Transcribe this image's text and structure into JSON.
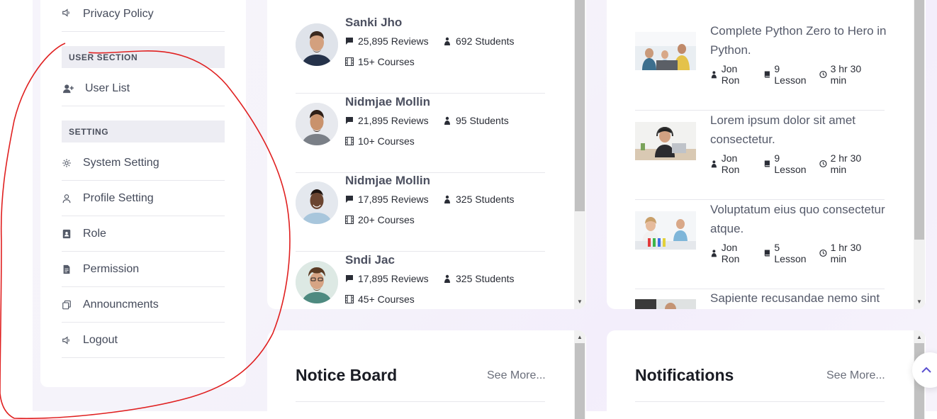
{
  "sidebar": {
    "top_item": {
      "label": "Privacy Policy",
      "icon": "speaker-icon"
    },
    "user_section": {
      "heading": "USER SECTION",
      "items": [
        {
          "label": "User List",
          "icon": "user-plus-icon"
        }
      ]
    },
    "setting_section": {
      "heading": "SETTING",
      "items": [
        {
          "label": "System Setting",
          "icon": "gear-icon"
        },
        {
          "label": "Profile Setting",
          "icon": "user-icon"
        },
        {
          "label": "Role",
          "icon": "id-card-icon"
        },
        {
          "label": "Permission",
          "icon": "document-icon"
        },
        {
          "label": "Announcments",
          "icon": "copy-icon"
        },
        {
          "label": "Logout",
          "icon": "speaker-icon"
        }
      ]
    }
  },
  "instructors": [
    {
      "name": "Sanki Jho",
      "reviews": "25,895 Reviews",
      "students": "692 Students",
      "courses": "15+ Courses"
    },
    {
      "name": "Nidmjae Mollin",
      "reviews": "21,895 Reviews",
      "students": "95 Students",
      "courses": "10+ Courses"
    },
    {
      "name": "Nidmjae Mollin",
      "reviews": "17,895 Reviews",
      "students": "325 Students",
      "courses": "20+ Courses"
    },
    {
      "name": "Sndi Jac",
      "reviews": "17,895 Reviews",
      "students": "325 Students",
      "courses": "45+ Courses"
    }
  ],
  "courses": [
    {
      "title": "Complete Python Zero to Hero in Python.",
      "author": "Jon Ron",
      "lessons": "9 Lesson",
      "duration": "3 hr 30 min"
    },
    {
      "title": "Lorem ipsum dolor sit amet consectetur.",
      "author": "Jon Ron",
      "lessons": "9 Lesson",
      "duration": "2 hr 30 min"
    },
    {
      "title": "Voluptatum eius quo consectetur atque.",
      "author": "Jon Ron",
      "lessons": "5 Lesson",
      "duration": "1 hr 30 min"
    },
    {
      "title": "Sapiente recusandae nemo sint",
      "author": "",
      "lessons": "",
      "duration": ""
    }
  ],
  "notice_board": {
    "title": "Notice Board",
    "see_more": "See More..."
  },
  "notifications": {
    "title": "Notifications",
    "see_more": "See More..."
  },
  "colors": {
    "accent": "#5a4fd0",
    "annotation": "#e02020"
  }
}
